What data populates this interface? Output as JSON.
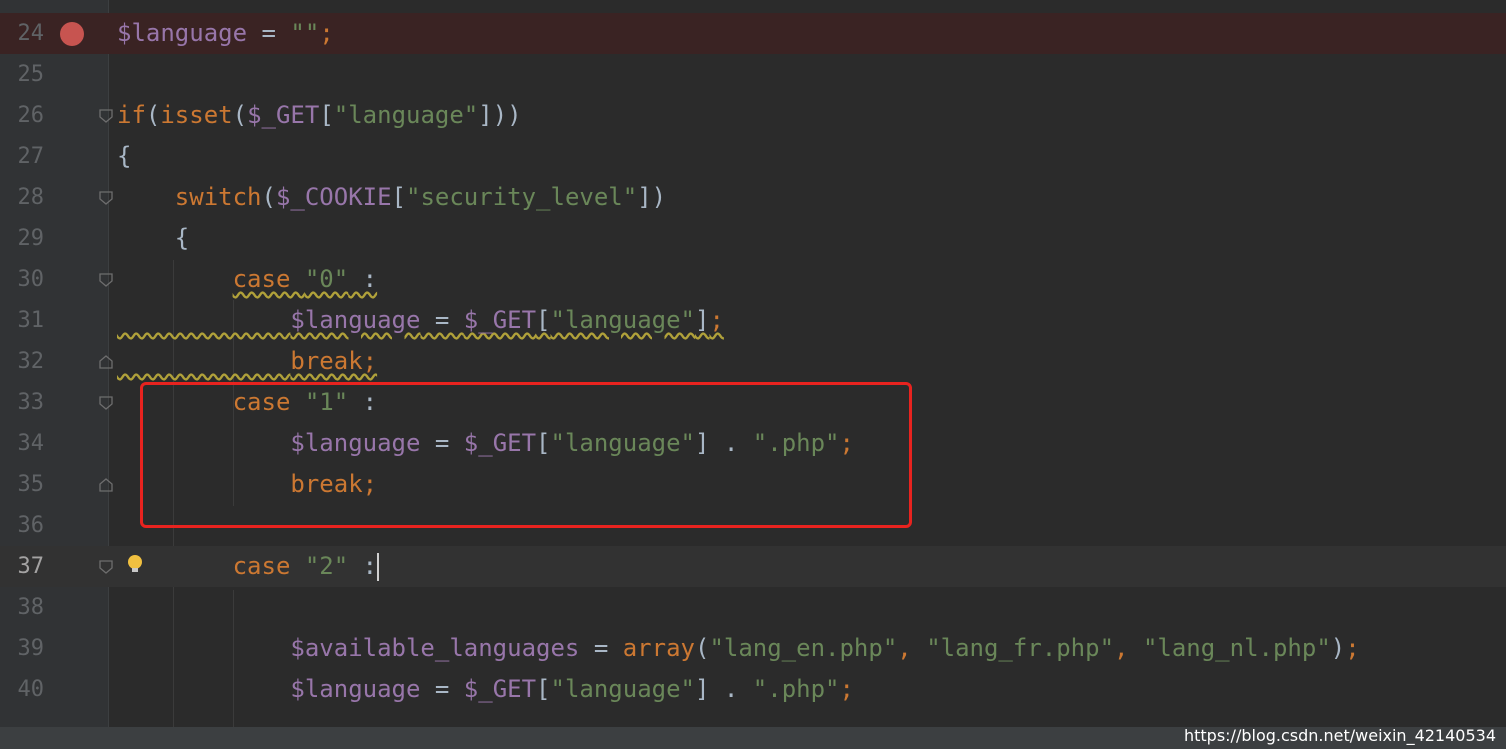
{
  "lines": [
    {
      "num": "24",
      "tokens": [
        {
          "c": "v",
          "t": "$language"
        },
        {
          "c": "p",
          "t": " = "
        },
        {
          "c": "s",
          "t": "\"\""
        },
        {
          "c": "k",
          "t": ";"
        }
      ]
    },
    {
      "num": "25",
      "tokens": []
    },
    {
      "num": "26",
      "tokens": [
        {
          "c": "k",
          "t": "if"
        },
        {
          "c": "p",
          "t": "("
        },
        {
          "c": "k",
          "t": "isset"
        },
        {
          "c": "p",
          "t": "("
        },
        {
          "c": "v",
          "t": "$_GET"
        },
        {
          "c": "p",
          "t": "["
        },
        {
          "c": "s",
          "t": "\"language\""
        },
        {
          "c": "p",
          "t": "]))"
        }
      ]
    },
    {
      "num": "27",
      "tokens": [
        {
          "c": "p",
          "t": "{"
        }
      ]
    },
    {
      "num": "28",
      "tokens": [
        {
          "c": "p",
          "t": "    "
        },
        {
          "c": "k",
          "t": "switch"
        },
        {
          "c": "p",
          "t": "("
        },
        {
          "c": "v",
          "t": "$_COOKIE"
        },
        {
          "c": "p",
          "t": "["
        },
        {
          "c": "s",
          "t": "\"security_level\""
        },
        {
          "c": "p",
          "t": "])"
        }
      ]
    },
    {
      "num": "29",
      "tokens": [
        {
          "c": "p",
          "t": "    {"
        }
      ]
    },
    {
      "num": "30",
      "tokens": [
        {
          "c": "p",
          "t": "        "
        },
        {
          "c": "k wavy",
          "t": "case "
        },
        {
          "c": "s wavy",
          "t": "\"0\""
        },
        {
          "c": "p wavy",
          "t": " :"
        }
      ]
    },
    {
      "num": "31",
      "tokens": [
        {
          "c": "p wavy",
          "t": "            "
        },
        {
          "c": "v wavy",
          "t": "$language"
        },
        {
          "c": "p wavy",
          "t": " = "
        },
        {
          "c": "v wavy",
          "t": "$_GET"
        },
        {
          "c": "p wavy",
          "t": "["
        },
        {
          "c": "s wavy",
          "t": "\"language\""
        },
        {
          "c": "p wavy",
          "t": "]"
        },
        {
          "c": "k wavy",
          "t": ";"
        }
      ]
    },
    {
      "num": "32",
      "tokens": [
        {
          "c": "p wavy",
          "t": "            "
        },
        {
          "c": "k wavy",
          "t": "break;"
        }
      ]
    },
    {
      "num": "33",
      "tokens": [
        {
          "c": "p",
          "t": "        "
        },
        {
          "c": "k",
          "t": "case "
        },
        {
          "c": "s",
          "t": "\"1\""
        },
        {
          "c": "p",
          "t": " :"
        }
      ]
    },
    {
      "num": "34",
      "tokens": [
        {
          "c": "p",
          "t": "            "
        },
        {
          "c": "v",
          "t": "$language"
        },
        {
          "c": "p",
          "t": " = "
        },
        {
          "c": "v",
          "t": "$_GET"
        },
        {
          "c": "p",
          "t": "["
        },
        {
          "c": "s",
          "t": "\"language\""
        },
        {
          "c": "p",
          "t": "] . "
        },
        {
          "c": "s",
          "t": "\".php\""
        },
        {
          "c": "k",
          "t": ";"
        }
      ]
    },
    {
      "num": "35",
      "tokens": [
        {
          "c": "p",
          "t": "            "
        },
        {
          "c": "k",
          "t": "break;"
        }
      ]
    },
    {
      "num": "36",
      "tokens": []
    },
    {
      "num": "37",
      "tokens": [
        {
          "c": "p",
          "t": "        "
        },
        {
          "c": "k",
          "t": "case "
        },
        {
          "c": "s",
          "t": "\"2\""
        },
        {
          "c": "p",
          "t": " :"
        }
      ]
    },
    {
      "num": "38",
      "tokens": []
    },
    {
      "num": "39",
      "tokens": [
        {
          "c": "p",
          "t": "            "
        },
        {
          "c": "v",
          "t": "$available_languages"
        },
        {
          "c": "p",
          "t": " = "
        },
        {
          "c": "k",
          "t": "array"
        },
        {
          "c": "p",
          "t": "("
        },
        {
          "c": "s",
          "t": "\"lang_en.php\""
        },
        {
          "c": "k",
          "t": ", "
        },
        {
          "c": "s",
          "t": "\"lang_fr.php\""
        },
        {
          "c": "k",
          "t": ", "
        },
        {
          "c": "s",
          "t": "\"lang_nl.php\""
        },
        {
          "c": "p",
          "t": ")"
        },
        {
          "c": "k",
          "t": ";"
        }
      ]
    },
    {
      "num": "40",
      "tokens": [
        {
          "c": "p",
          "t": "            "
        },
        {
          "c": "v",
          "t": "$language"
        },
        {
          "c": "p",
          "t": " = "
        },
        {
          "c": "v",
          "t": "$_GET"
        },
        {
          "c": "p",
          "t": "["
        },
        {
          "c": "s",
          "t": "\"language\""
        },
        {
          "c": "p",
          "t": "] . "
        },
        {
          "c": "s",
          "t": "\".php\""
        },
        {
          "c": "k",
          "t": ";"
        }
      ]
    }
  ],
  "colors": {
    "keyword": "#cc7832",
    "variable": "#9876aa",
    "string": "#6a8759",
    "plain": "#a9b7c6",
    "highlight_box": "#e8231f",
    "breakpoint": "#c75450"
  },
  "watermark": "https://blog.csdn.net/weixin_42140534"
}
